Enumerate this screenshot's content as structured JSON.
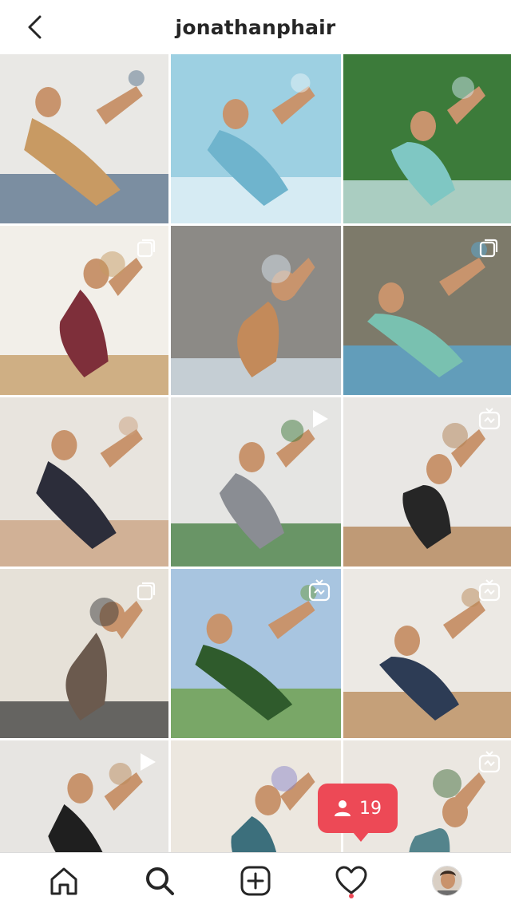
{
  "header": {
    "username": "jonathanphair",
    "back_icon": "chevron-left-icon"
  },
  "grid": {
    "posts": [
      {
        "name": "post-seated-yoga-blocks",
        "badge": null,
        "colors": [
          "#e9e8e5",
          "#c89a63",
          "#55708a"
        ]
      },
      {
        "name": "post-handstand-tunnel",
        "badge": null,
        "colors": [
          "#9dd0e2",
          "#6fb4cd",
          "#e9f4f8"
        ]
      },
      {
        "name": "post-infinity-pool",
        "badge": null,
        "colors": [
          "#3c7b3a",
          "#7fc7c3",
          "#cfe8ef"
        ]
      },
      {
        "name": "post-assisted-stretch",
        "badge": "carousel",
        "colors": [
          "#f2efe9",
          "#7e2f3a",
          "#c39a62"
        ]
      },
      {
        "name": "post-crow-pose-blocks",
        "badge": null,
        "colors": [
          "#8c8a86",
          "#c38a5a",
          "#d8e4ee"
        ]
      },
      {
        "name": "post-climbing-hug",
        "badge": "carousel",
        "colors": [
          "#7d7a6a",
          "#79c1b0",
          "#5aa9d6"
        ]
      },
      {
        "name": "post-partner-yoga",
        "badge": null,
        "colors": [
          "#e8e4de",
          "#2c2d3a",
          "#caa07d"
        ]
      },
      {
        "name": "post-neck-massage",
        "badge": "video",
        "colors": [
          "#e5e5e3",
          "#8a8d93",
          "#3f7a3c"
        ]
      },
      {
        "name": "post-inversion-doors",
        "badge": "igtv",
        "colors": [
          "#e9e7e4",
          "#262626",
          "#b08051"
        ]
      },
      {
        "name": "post-arm-balance-mat",
        "badge": "carousel",
        "colors": [
          "#e6e1d8",
          "#6b5a4e",
          "#3a3a3a"
        ]
      },
      {
        "name": "post-meditation-outdoors",
        "badge": "igtv",
        "colors": [
          "#a8c5e0",
          "#2f5b2c",
          "#6a9c3f"
        ]
      },
      {
        "name": "post-lunge-stretch",
        "badge": "igtv",
        "colors": [
          "#ece9e4",
          "#2d3c55",
          "#b88756"
        ]
      },
      {
        "name": "post-side-angle-pose",
        "badge": "video",
        "colors": [
          "#e7e5e2",
          "#1f1f1f",
          "#b98a5a"
        ]
      },
      {
        "name": "post-twisted-lunge-dog",
        "badge": null,
        "colors": [
          "#ece7df",
          "#3c6f7c",
          "#8a86c9"
        ]
      },
      {
        "name": "post-seated-side-bend",
        "badge": "igtv",
        "colors": [
          "#ebe7e1",
          "#54848c",
          "#3f6b3a"
        ]
      }
    ]
  },
  "activity": {
    "follower_count": "19",
    "icon": "person-icon"
  },
  "bottom_nav": {
    "items": [
      {
        "name": "home-icon"
      },
      {
        "name": "search-icon"
      },
      {
        "name": "new-post-icon"
      },
      {
        "name": "heart-icon"
      },
      {
        "name": "profile-avatar"
      }
    ]
  },
  "colors": {
    "accent": "#ed4956",
    "text": "#262626",
    "divider": "#dbdbdb"
  }
}
